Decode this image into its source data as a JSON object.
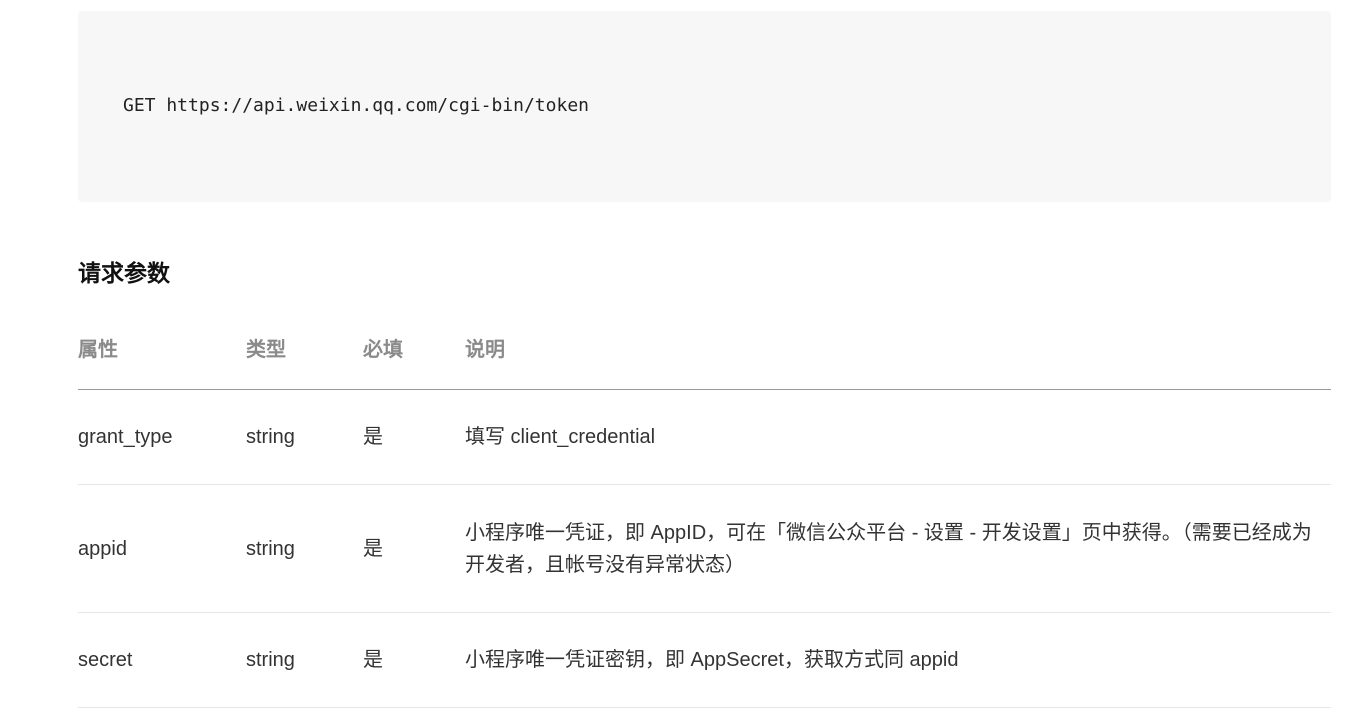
{
  "code_block": {
    "line": "GET https://api.weixin.qq.com/cgi-bin/token"
  },
  "section_title": "请求参数",
  "table": {
    "headers": {
      "name": "属性",
      "type": "类型",
      "required": "必填",
      "description": "说明"
    },
    "rows": [
      {
        "name": "grant_type",
        "type": "string",
        "required": "是",
        "description": "填写 client_credential"
      },
      {
        "name": "appid",
        "type": "string",
        "required": "是",
        "description": "小程序唯一凭证，即 AppID，可在「微信公众平台 - 设置 - 开发设置」页中获得。（需要已经成为开发者，且帐号没有异常状态）"
      },
      {
        "name": "secret",
        "type": "string",
        "required": "是",
        "description": "小程序唯一凭证密钥，即 AppSecret，获取方式同 appid"
      }
    ]
  }
}
